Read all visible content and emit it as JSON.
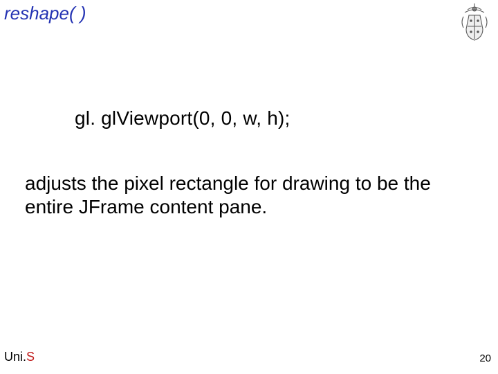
{
  "title": "reshape(  )",
  "code": "gl. glViewport(0, 0, w, h);",
  "paragraph": "adjusts the pixel rectangle for drawing to be the entire JFrame content pane.",
  "footer": {
    "uni": "Uni.",
    "s": "S"
  },
  "pageNumber": "20"
}
